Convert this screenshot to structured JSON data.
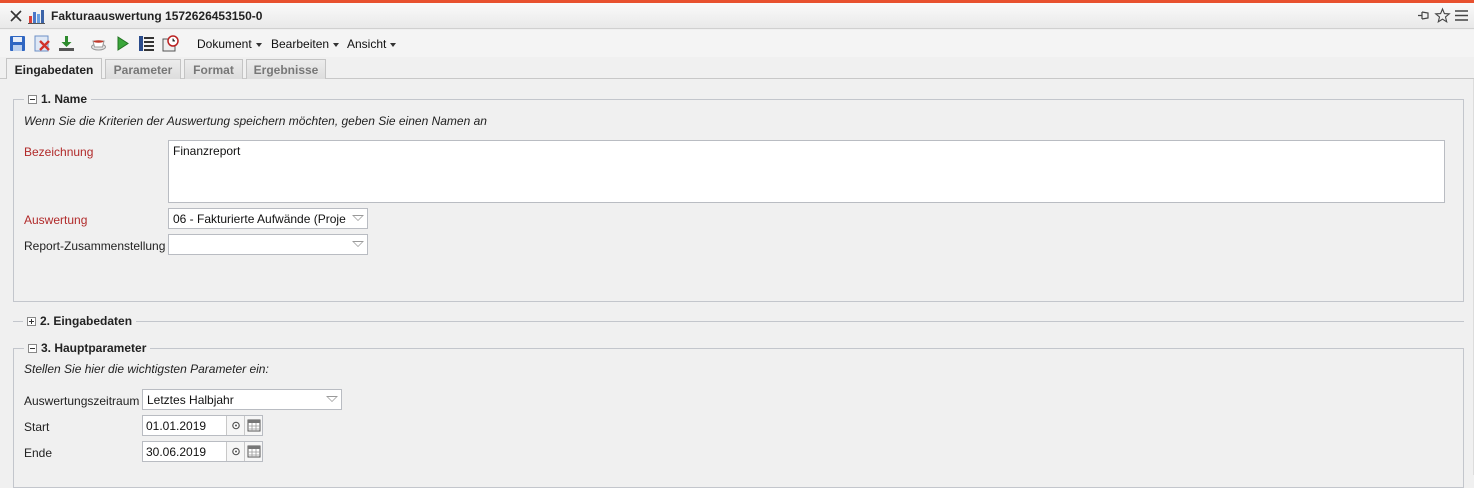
{
  "window": {
    "title": "Fakturaauswertung 1572626453150-0"
  },
  "toolbar": {
    "menus": [
      "Dokument",
      "Bearbeiten",
      "Ansicht"
    ]
  },
  "tabs": [
    "Eingabedaten",
    "Parameter",
    "Format",
    "Ergebnisse"
  ],
  "section1": {
    "legend": "1. Name",
    "hint": "Wenn Sie die Kriterien der Auswertung speichern möchten, geben Sie einen Namen an",
    "bezeichnung_label": "Bezeichnung",
    "bezeichnung_value": "Finanzreport",
    "auswertung_label": "Auswertung",
    "auswertung_value": "06 - Fakturierte Aufwände (Proje",
    "report_label": "Report-Zusammenstellung",
    "report_value": ""
  },
  "section2": {
    "legend": "2. Eingabedaten"
  },
  "section3": {
    "legend": "3. Hauptparameter",
    "hint": "Stellen Sie hier die wichtigsten Parameter ein:",
    "zeitraum_label": "Auswertungszeitraum",
    "zeitraum_value": "Letztes Halbjahr",
    "start_label": "Start",
    "start_value": "01.01.2019",
    "ende_label": "Ende",
    "ende_value": "30.06.2019"
  },
  "colors": {
    "accent": "#e8512f",
    "required_label": "#b12a2a"
  }
}
